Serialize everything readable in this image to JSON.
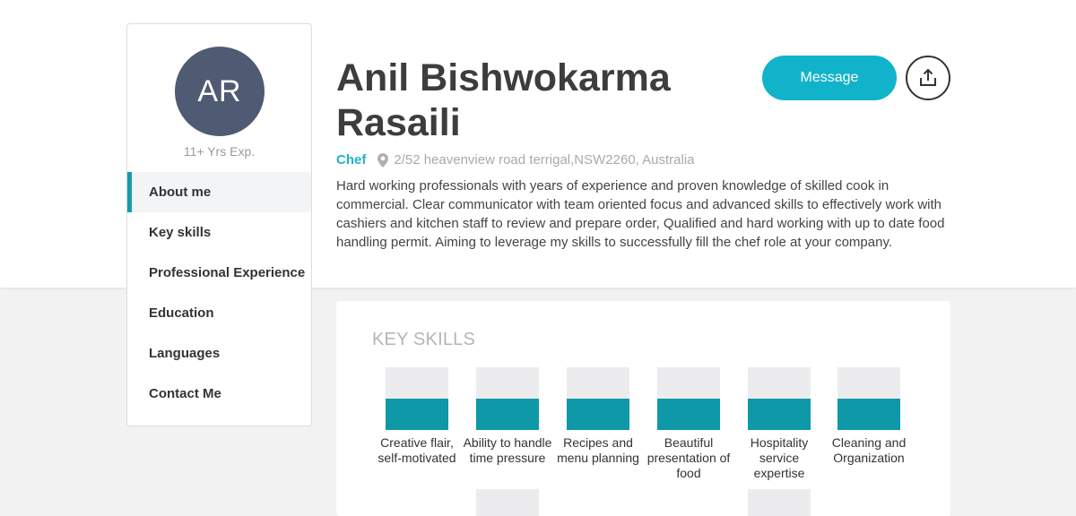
{
  "sidebar": {
    "avatar_initials": "AR",
    "experience": "11+ Yrs Exp.",
    "items": [
      {
        "label": "About me",
        "active": true
      },
      {
        "label": "Key skills",
        "active": false
      },
      {
        "label": "Professional Experience",
        "active": false
      },
      {
        "label": "Education",
        "active": false
      },
      {
        "label": "Languages",
        "active": false
      },
      {
        "label": "Contact Me",
        "active": false
      }
    ]
  },
  "profile": {
    "name": "Anil Bishwokarma Rasaili",
    "role": "Chef",
    "address": "2/52 heavenview road terrigal,NSW2260, Australia",
    "about": "Hard working professionals with years of experience and proven knowledge of skilled cook in commercial. Clear communicator with team oriented focus and advanced skills to effectively work with cashiers and kitchen staff to review and prepare order, Qualified and hard working with up to date food handling permit. Aiming to leverage my skills to successfully fill the chef role at your company."
  },
  "actions": {
    "message_label": "Message",
    "share_icon": "share-icon"
  },
  "skills": {
    "title": "KEY SKILLS",
    "items": [
      {
        "label": "Creative flair, self-motivated",
        "level": 0.5
      },
      {
        "label": "Ability to handle time pressure",
        "level": 0.5
      },
      {
        "label": "Recipes and menu planning",
        "level": 0.5
      },
      {
        "label": "Beautiful presentation of food",
        "level": 0.5
      },
      {
        "label": "Hospitality service expertise",
        "level": 0.5
      },
      {
        "label": "Cleaning and Organization",
        "level": 0.5
      }
    ]
  },
  "colors": {
    "accent": "#11b3cb",
    "skill_fill": "#0f98a8",
    "avatar_bg": "#4f5a73"
  }
}
